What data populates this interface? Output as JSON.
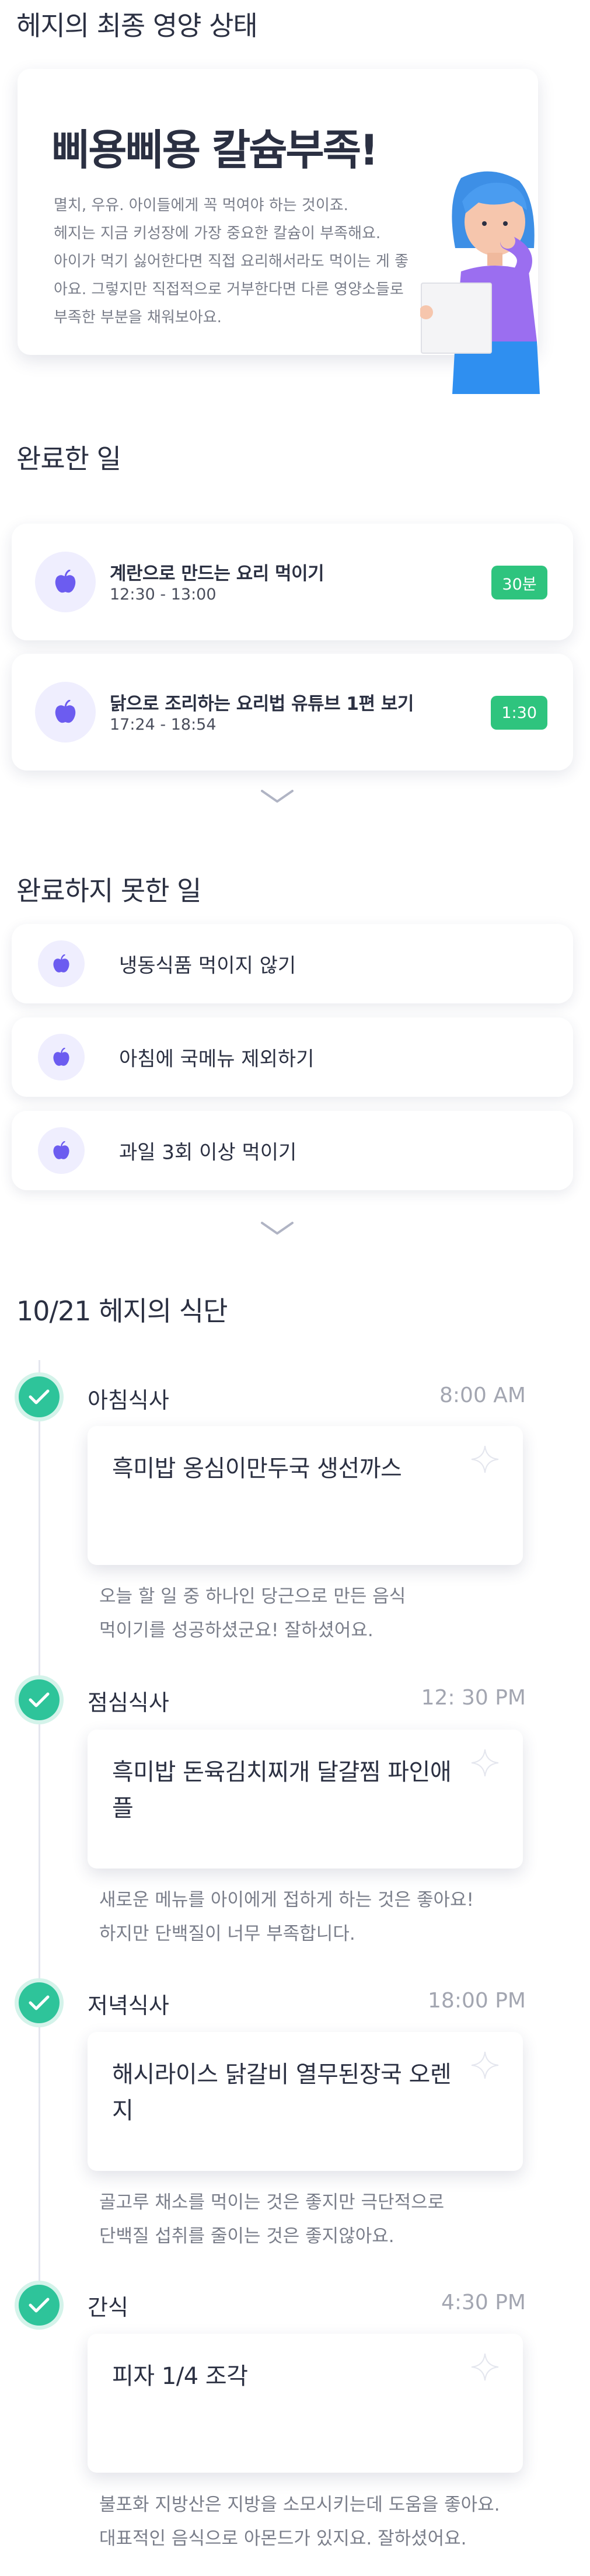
{
  "status": {
    "section_title": "헤지의 최종 영양 상태",
    "headline": "삐용삐용 칼슘부족!",
    "body_lines": [
      "멸치, 우유. 아이들에게 꼭 먹여야 하는 것이죠.",
      "헤지는 지금 키성장에 가장 중요한 칼슘이 부족해요.",
      "아이가 먹기 싫어한다면 직접 요리해서라도 먹이는 게 좋",
      "아요. 그렇지만 직접적으로 거부한다면 다른 영양소들로",
      "부족한 부분을 채워보아요."
    ]
  },
  "done": {
    "section_title": "완료한 일",
    "items": [
      {
        "title": "계란으로 만드는 요리 먹이기",
        "time": "12:30 - 13:00",
        "duration": "30분"
      },
      {
        "title": "닭으로 조리하는 요리법 유튜브 1편 보기",
        "time": "17:24 - 18:54",
        "duration": "1:30"
      }
    ]
  },
  "undone": {
    "section_title": "완료하지 못한 일",
    "items": [
      {
        "title": "냉동식품 먹이지 않기"
      },
      {
        "title": "아침에 국메뉴 제외하기"
      },
      {
        "title": "과일 3회 이상 먹이기"
      }
    ]
  },
  "diet": {
    "section_title": "10/21 헤지의 식단",
    "meals": [
      {
        "title": "아침식사",
        "time": "8:00 AM",
        "menu": "흑미밥 옹심이만두국 생선까스",
        "comment_lines": [
          "오늘 할 일 중 하나인 당근으로 만든 음식",
          "먹이기를 성공하셨군요! 잘하셨어요."
        ]
      },
      {
        "title": "점심식사",
        "time": "12: 30 PM",
        "menu": "흑미밥 돈육김치찌개 달걀찜 파인애플",
        "comment_lines": [
          "새로운 메뉴를 아이에게 접하게 하는 것은 좋아요!",
          "하지만 단백질이 너무 부족합니다."
        ]
      },
      {
        "title": "저녁식사",
        "time": "18:00 PM",
        "menu": "해시라이스 닭갈비 열무된장국 오렌지",
        "comment_lines": [
          "골고루 채소를 먹이는 것은 좋지만 극단적으로",
          "단백질 섭취를 줄이는 것은 좋지않아요."
        ]
      },
      {
        "title": "간식",
        "time": "4:30 PM",
        "menu": "피자 1/4 조각",
        "comment_lines": [
          "불포화 지방산은 지방을 소모시키는데 도움을 좋아요.",
          "대표적인 음식으로 아몬드가 있지요. 잘하셨어요."
        ]
      }
    ]
  },
  "colors": {
    "accent_purple": "#6c5cf0",
    "badge_green": "#2ec47e",
    "check_teal": "#2ec49a",
    "text_dark": "#2b3042",
    "text_muted": "#7a7e8a"
  },
  "icons": {
    "task_icon": "apple-icon",
    "expand_icon": "chevron-down-icon",
    "meal_check_icon": "check-icon",
    "card_icon": "sparkle-star-icon"
  }
}
